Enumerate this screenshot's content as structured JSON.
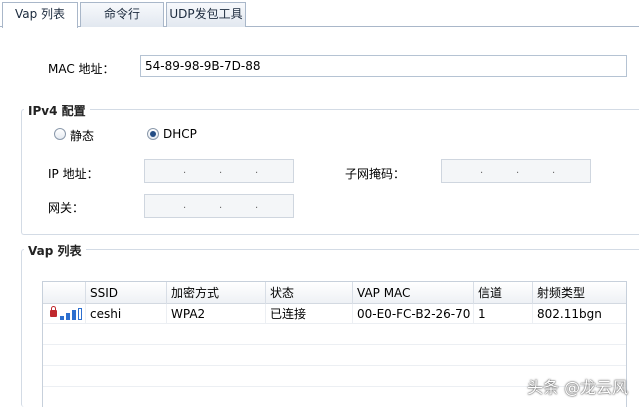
{
  "tabs": [
    {
      "label": "Vap 列表",
      "active": true
    },
    {
      "label": "命令行",
      "active": false
    },
    {
      "label": "UDP发包工具",
      "active": false
    }
  ],
  "mac": {
    "label": "MAC 地址：",
    "value": "54-89-98-9B-7D-88"
  },
  "ipv4": {
    "title": "IPv4 配置",
    "static_label": "静态",
    "dhcp_label": "DHCP",
    "selected": "DHCP",
    "ip_label": "IP 地址：",
    "mask_label": "子网掩码：",
    "gateway_label": "网关：",
    "dot": "."
  },
  "vap": {
    "title": "Vap 列表",
    "columns": [
      "",
      "SSID",
      "加密方式",
      "状态",
      "VAP MAC",
      "信道",
      "射频类型"
    ],
    "rows": [
      {
        "ssid": "ceshi",
        "encryption": "WPA2",
        "status": "已连接",
        "vap_mac": "00-E0-FC-B2-26-70",
        "channel": "1",
        "radio_type": "802.11bgn",
        "icons": [
          "lock-icon",
          "signal-icon"
        ],
        "signal_level": 3,
        "signal_max": 4
      }
    ]
  },
  "watermark": "头条 @龙云风",
  "colors": {
    "accent": "#2d6fcf",
    "lock": "#c0282d",
    "border": "#a9b7c9"
  }
}
